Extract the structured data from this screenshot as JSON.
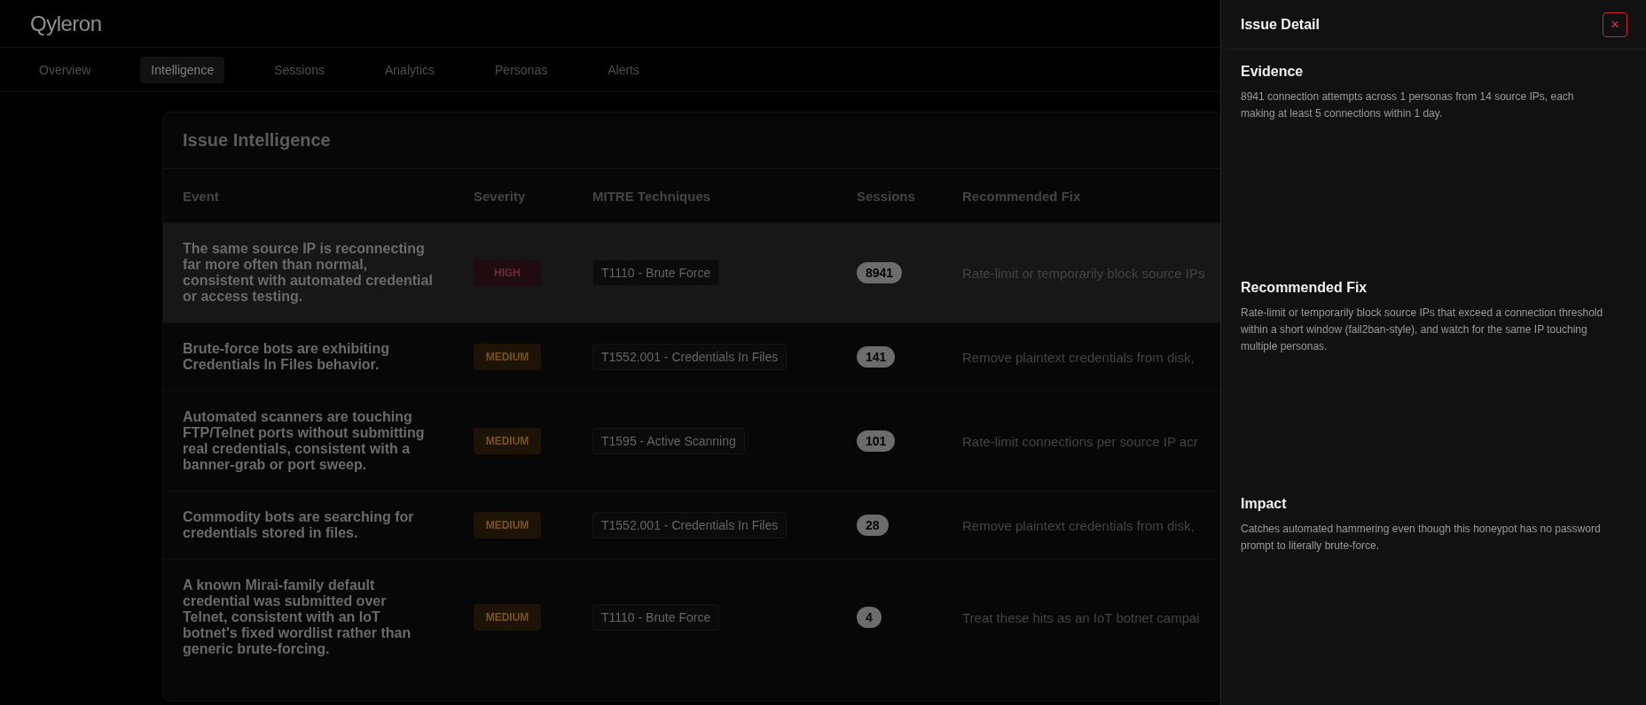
{
  "app": {
    "logo": "Qyleron"
  },
  "tabs": [
    {
      "label": "Overview",
      "selected": false
    },
    {
      "label": "Intelligence",
      "selected": true
    },
    {
      "label": "Sessions",
      "selected": false
    },
    {
      "label": "Analytics",
      "selected": false
    },
    {
      "label": "Personas",
      "selected": false
    },
    {
      "label": "Alerts",
      "selected": false
    }
  ],
  "table": {
    "title": "Issue Intelligence",
    "columns": [
      "Event",
      "Severity",
      "MITRE Techniques",
      "Sessions",
      "Recommended Fix"
    ],
    "rows": [
      {
        "selected": true,
        "event": "The same source IP is reconnecting far more often than normal, consistent with automated credential or access testing.",
        "severity": {
          "kind": "high",
          "label": "HIGH"
        },
        "technique": "T1110 - Brute Force",
        "sessions": "8941",
        "fix": "Rate-limit or temporarily block source IPs"
      },
      {
        "selected": false,
        "event": "Brute-force bots are exhibiting Credentials In Files behavior.",
        "severity": {
          "kind": "medium",
          "label": "MEDIUM"
        },
        "technique": "T1552.001 - Credentials In Files",
        "sessions": "141",
        "fix": "Remove plaintext credentials from disk,"
      },
      {
        "selected": false,
        "event": "Automated scanners are touching FTP/Telnet ports without submitting real credentials, consistent with a banner-grab or port sweep.",
        "severity": {
          "kind": "medium",
          "label": "MEDIUM"
        },
        "technique": "T1595 - Active Scanning",
        "sessions": "101",
        "fix": "Rate-limit connections per source IP acr"
      },
      {
        "selected": false,
        "event": "Commodity bots are searching for credentials stored in files.",
        "severity": {
          "kind": "medium",
          "label": "MEDIUM"
        },
        "technique": "T1552.001 - Credentials In Files",
        "sessions": "28",
        "fix": "Remove plaintext credentials from disk,"
      },
      {
        "selected": false,
        "event": "A known Mirai-family default credential was submitted over Telnet, consistent with an IoT botnet's fixed wordlist rather than generic brute-forcing.",
        "severity": {
          "kind": "medium",
          "label": "MEDIUM"
        },
        "technique": "T1110 - Brute Force",
        "sessions": "4",
        "fix": "Treat these hits as an IoT botnet campai"
      }
    ]
  },
  "detail_panel": {
    "title": "Issue Detail",
    "close": "×",
    "sections": [
      {
        "heading": "Evidence",
        "body": "8941 connection attempts across 1 personas from 14 source IPs, each making at least 5 connections within 1 day."
      },
      {
        "heading": "Recommended Fix",
        "body": "Rate-limit or temporarily block source IPs that exceed a connection threshold within a short window (fail2ban-style), and watch for the same IP touching multiple personas."
      },
      {
        "heading": "Impact",
        "body": "Catches automated hammering even though this honeypot has no password prompt to literally brute-force."
      }
    ]
  }
}
